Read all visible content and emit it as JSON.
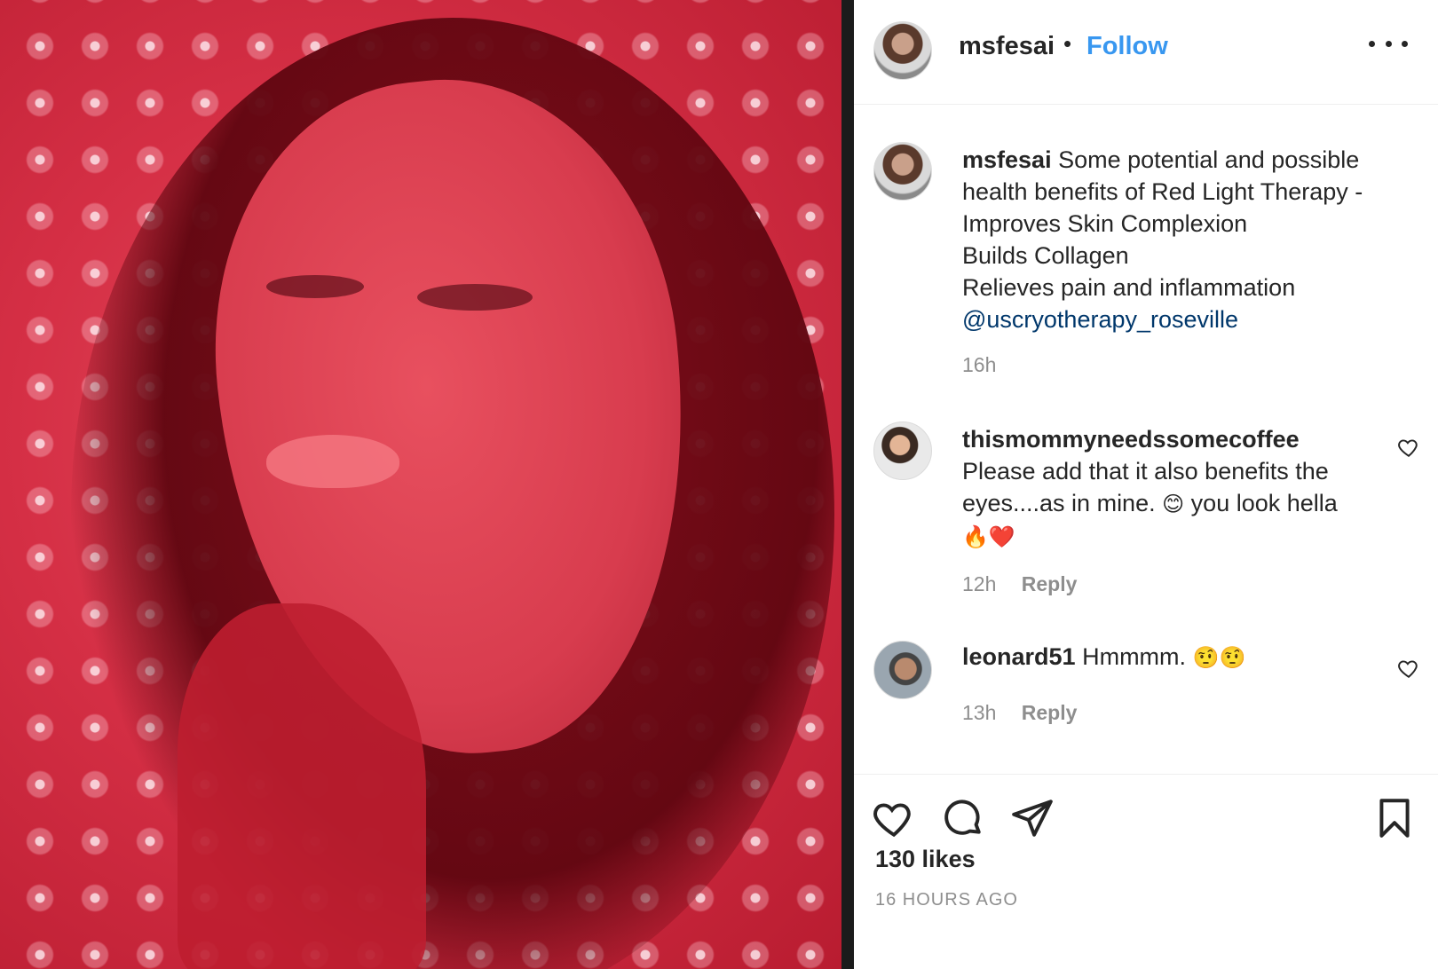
{
  "post": {
    "author": "msfesai",
    "separator": "•",
    "follow_label": "Follow",
    "image_alt": "Portrait in red light therapy",
    "caption": {
      "username": "msfesai",
      "lines": [
        "Some potential and possible",
        "health benefits of Red Light Therapy -",
        "Improves Skin Complexion",
        "Builds Collagen",
        "Relieves pain and inflammation"
      ],
      "mention": "@uscryotherapy_roseville",
      "time": "16h"
    }
  },
  "comments": [
    {
      "username": "thismommyneedssomecoffee",
      "text_line1": "Please add that it also benefits the",
      "text_line2_a": "eyes....as in mine.",
      "emoji_smile": "😊",
      "text_line2_b": "you look hella",
      "emoji_line3": "🔥❤️",
      "time": "12h",
      "reply_label": "Reply"
    },
    {
      "username": "leonard51",
      "text": "Hmmmm.",
      "emoji": "🤨🤨",
      "time": "13h",
      "reply_label": "Reply"
    }
  ],
  "footer": {
    "likes": "130 likes",
    "time_ago": "16 HOURS AGO"
  },
  "icons": {
    "more": "more-options-icon",
    "like": "heart-icon",
    "comment": "comment-bubble-icon",
    "share": "paper-plane-icon",
    "save": "bookmark-icon"
  },
  "colors": {
    "follow": "#3897f0",
    "mention": "#00376b",
    "muted": "#8e8e8e",
    "photo_red": "#d52f45"
  }
}
